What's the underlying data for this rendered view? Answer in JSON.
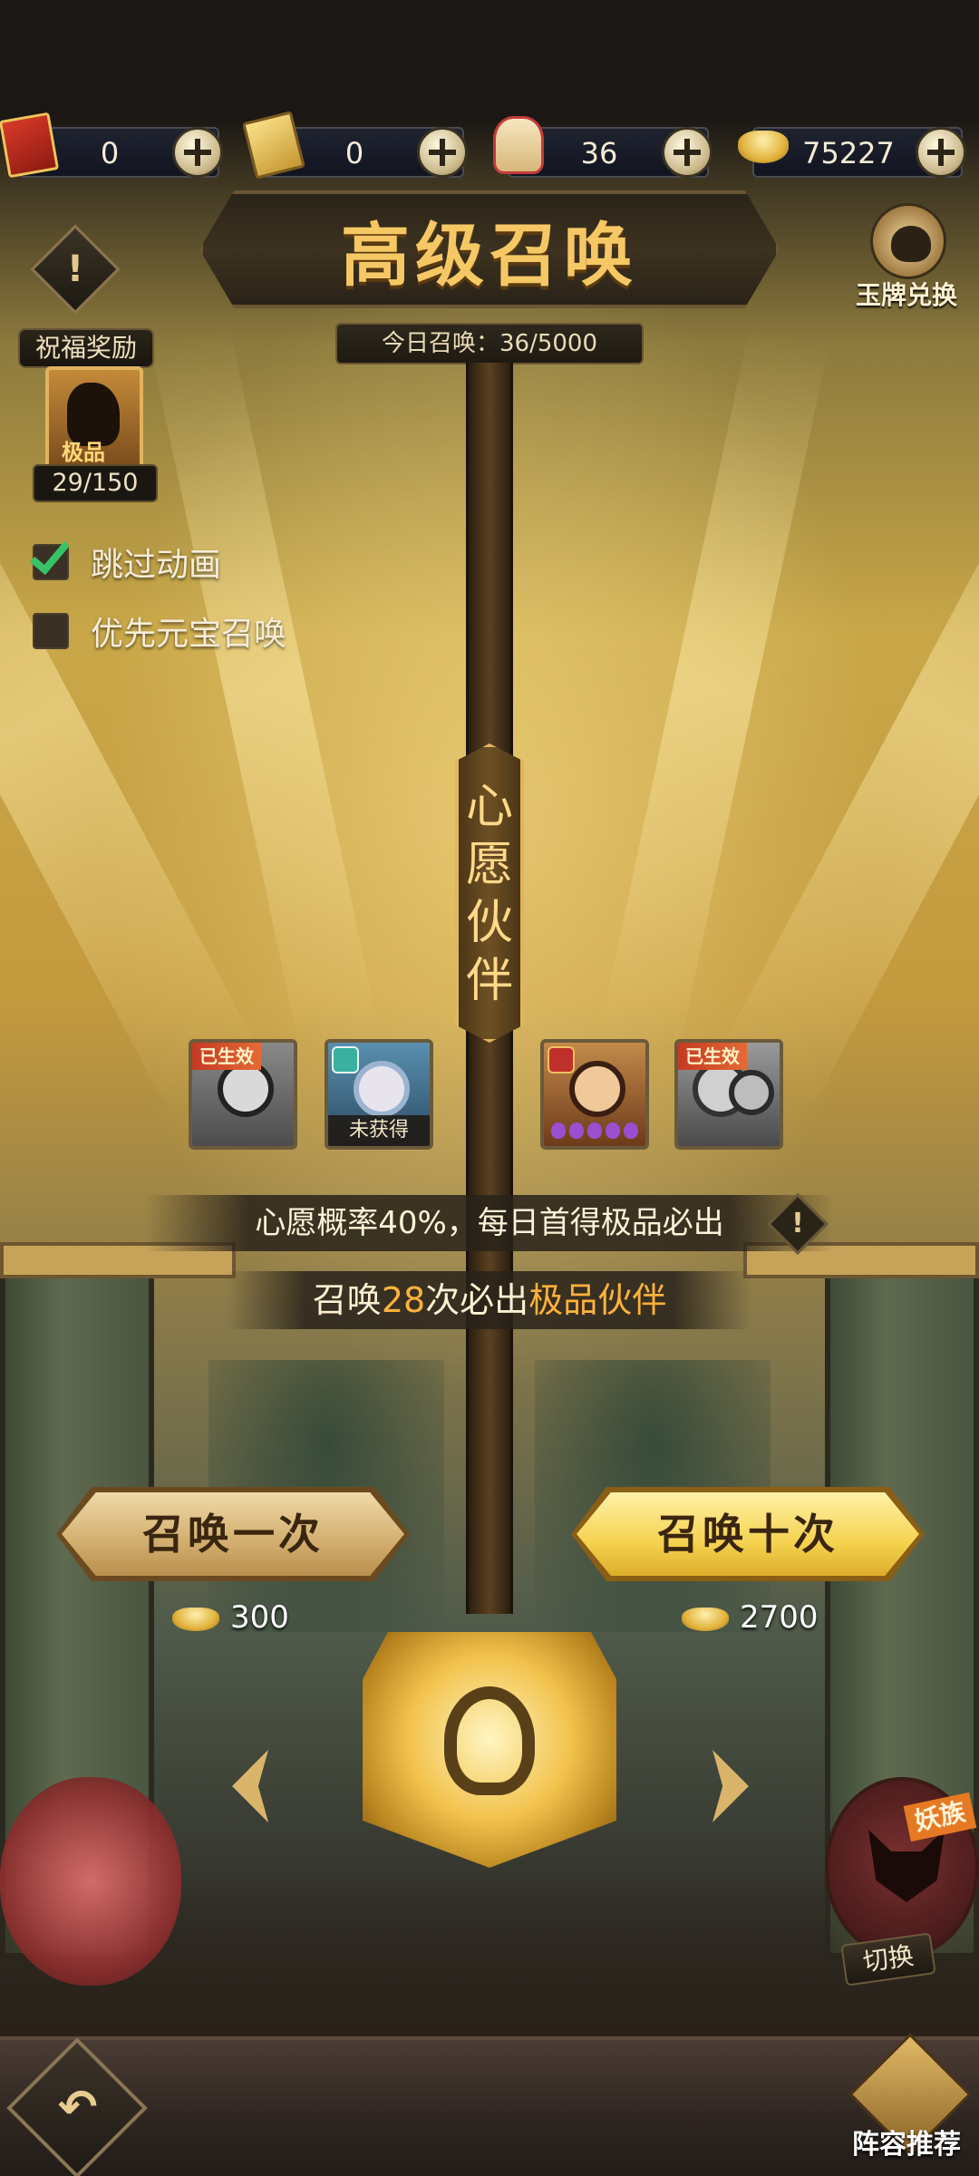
{
  "resources": [
    {
      "icon": "red-envelope-icon",
      "value": "0"
    },
    {
      "icon": "gold-ticket-icon",
      "value": "0"
    },
    {
      "icon": "lucky-bag-icon",
      "value": "36"
    },
    {
      "icon": "gold-ingot-icon",
      "value": "75227"
    }
  ],
  "header": {
    "title": "高级召唤",
    "today_summons": "今日召唤：36/5000",
    "jade_exchange_label": "玉牌兑换"
  },
  "blessing": {
    "label": "祝福奖励",
    "tier": "极品",
    "progress": "29/150"
  },
  "options": [
    {
      "label": "跳过动画",
      "checked": true
    },
    {
      "label": "优先元宝召唤",
      "checked": false
    }
  ],
  "wish": {
    "title_chars": [
      "心",
      "愿",
      "伙",
      "伴"
    ],
    "slots": [
      {
        "ribbon": "已生效",
        "status": "",
        "stars": 0
      },
      {
        "ribbon": "",
        "status": "未获得",
        "stars": 0
      },
      {
        "ribbon": "",
        "status": "",
        "stars": 5
      },
      {
        "ribbon": "已生效",
        "status": "",
        "stars": 0
      }
    ],
    "info": "心愿概率40%，每日首得极品必出",
    "guarantee_prefix": "召唤",
    "guarantee_count": "28",
    "guarantee_middle": "次必出",
    "guarantee_reward": "极品伙伴"
  },
  "summon": {
    "once_label": "召唤一次",
    "once_cost": "300",
    "ten_label": "召唤十次",
    "ten_cost": "2700"
  },
  "faction": {
    "tag": "妖族",
    "switch_label": "切换"
  },
  "bottom": {
    "lineup_label": "阵容推荐"
  },
  "colors": {
    "highlight": "#ffb23c",
    "title": "#f6c865",
    "check": "#39c167"
  }
}
